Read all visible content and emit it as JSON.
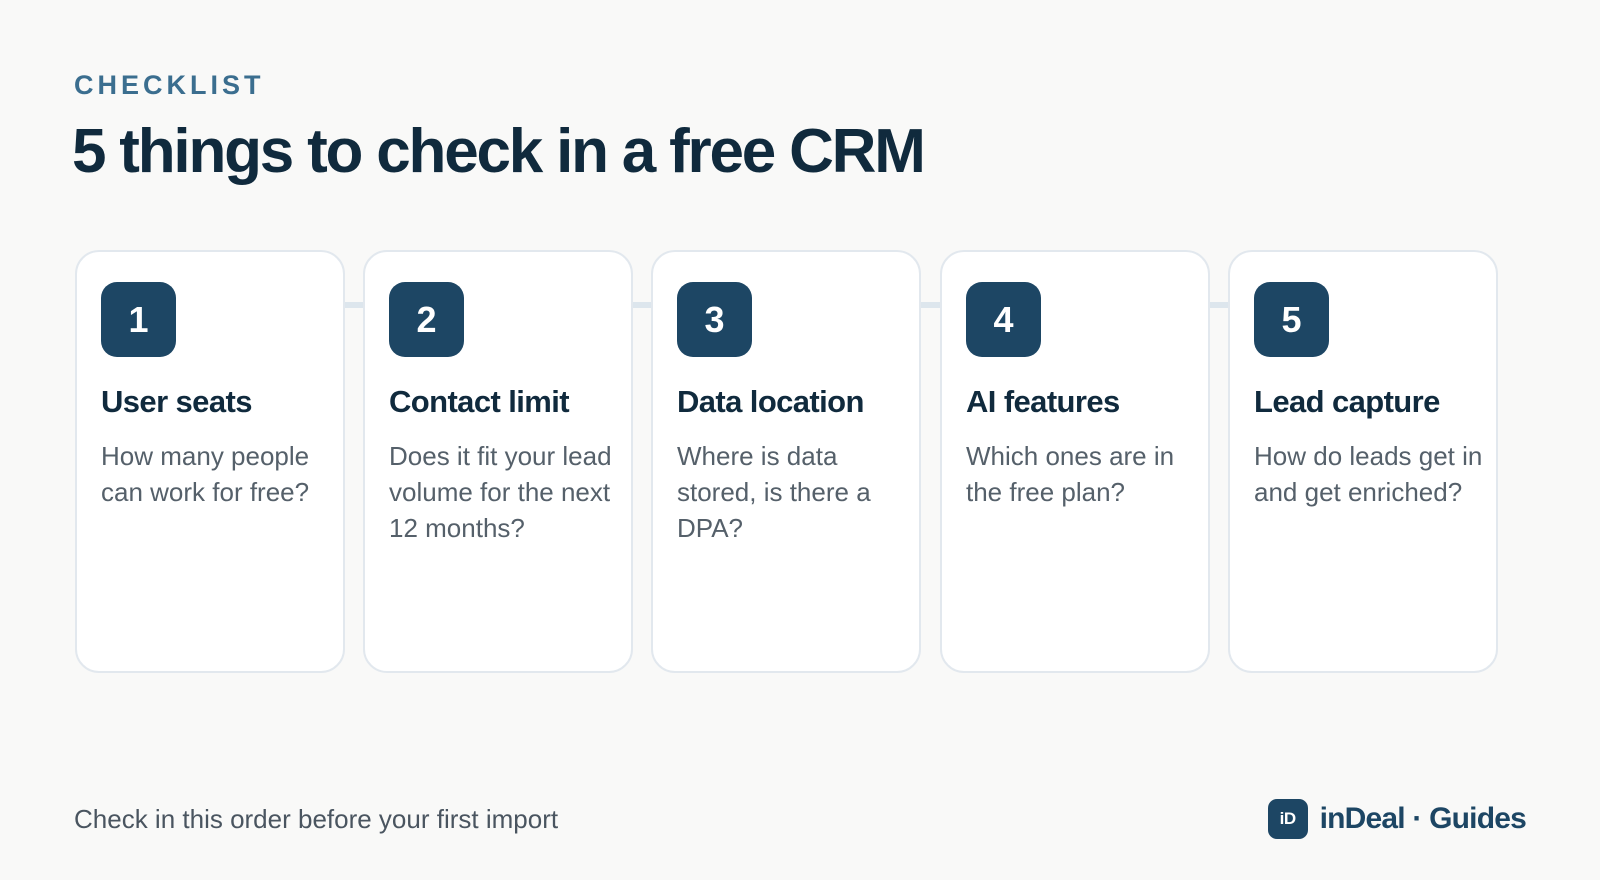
{
  "header": {
    "eyebrow": "CHECKLIST",
    "title": "5 things to check in a free CRM"
  },
  "cards": [
    {
      "number": "1",
      "title": "User seats",
      "description": "How many people can work for free?"
    },
    {
      "number": "2",
      "title": "Contact limit",
      "description": "Does it fit your lead volume for the next 12 months?"
    },
    {
      "number": "3",
      "title": "Data location",
      "description": "Where is data stored, is there a DPA?"
    },
    {
      "number": "4",
      "title": "AI features",
      "description": "Which ones are in the free plan?"
    },
    {
      "number": "5",
      "title": "Lead capture",
      "description": "How do leads get in and get enriched?"
    }
  ],
  "footer": {
    "note": "Check in this order before your first import",
    "brand_logo": "iD",
    "brand_name": "inDeal · Guides"
  },
  "colors": {
    "background": "#f9f9f8",
    "accent": "#1d4664",
    "eyebrow": "#3b6e8f",
    "heading": "#102a3d",
    "body_text": "#55606a",
    "card_border": "#e2e8ee",
    "connector": "#dde6ed"
  }
}
